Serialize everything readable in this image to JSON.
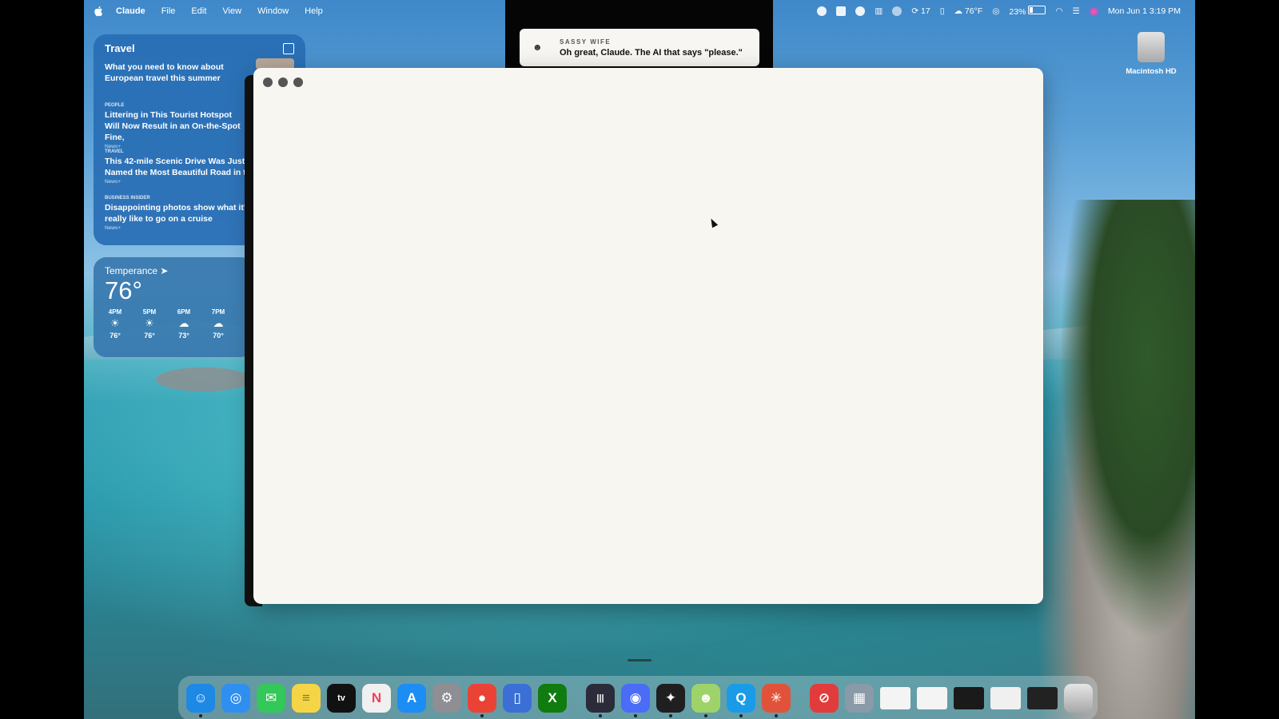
{
  "menubar": {
    "app_name": "Claude",
    "menus": [
      "File",
      "Edit",
      "View",
      "Window",
      "Help"
    ],
    "status": {
      "badge_count": "17",
      "weather": "76°F",
      "battery": "23%",
      "datetime": "Mon Jun 1  3:19 PM"
    }
  },
  "notification": {
    "title": "SASSY WIFE",
    "message": "Oh great, Claude. The AI that says \"please.\""
  },
  "news_widget": {
    "title": "Travel",
    "stories": [
      {
        "source": "",
        "headline": "What you need to know about European travel this summer",
        "tag": ""
      },
      {
        "source": "People",
        "headline": "Littering in This Tourist Hotspot Will Now Result in an On-the-Spot Fine,",
        "tag": "News+"
      },
      {
        "source": "Travel",
        "headline": "This 42-mile Scenic Drive Was Just Named the Most Beautiful Road in t",
        "tag": "News+"
      },
      {
        "source": "BUSINESS INSIDER",
        "headline": "Disappointing photos show what it' really like to go on a cruise",
        "tag": "News+"
      }
    ]
  },
  "weather_widget": {
    "location": "Temperance",
    "temperature": "76°",
    "hours": [
      {
        "time": "4PM",
        "icon": "sun",
        "temp": "76°"
      },
      {
        "time": "5PM",
        "icon": "sun",
        "temp": "76°"
      },
      {
        "time": "6PM",
        "icon": "cloud",
        "temp": "73°"
      },
      {
        "time": "7PM",
        "icon": "cloud",
        "temp": "70°"
      }
    ]
  },
  "desktop": {
    "drive_label": "Macintosh HD"
  },
  "dock": {
    "apps": [
      {
        "name": "finder",
        "glyph": "☺",
        "color": "#1e88e5",
        "running": true
      },
      {
        "name": "safari",
        "glyph": "◎",
        "color": "#2f8ff0",
        "running": false
      },
      {
        "name": "messages",
        "glyph": "✉",
        "color": "#34c759",
        "running": false
      },
      {
        "name": "notes",
        "glyph": "≡",
        "color": "#f5d546",
        "running": false
      },
      {
        "name": "apple-tv",
        "glyph": "tv",
        "color": "#111111",
        "running": false
      },
      {
        "name": "news",
        "glyph": "N",
        "color": "#f0f0f0",
        "running": false
      },
      {
        "name": "app-store",
        "glyph": "A",
        "color": "#1c8df5",
        "running": false
      },
      {
        "name": "system-settings",
        "glyph": "⚙",
        "color": "#8e8e93",
        "running": false
      },
      {
        "name": "chrome",
        "glyph": "●",
        "color": "#ea4335",
        "running": true
      },
      {
        "name": "simulator",
        "glyph": "▯",
        "color": "#3b6fd6",
        "running": false
      },
      {
        "name": "xbox-cloud-gaming",
        "glyph": "X",
        "color": "#107c10",
        "running": false
      },
      {
        "name": "audio-app",
        "glyph": "|||",
        "color": "#2b2b3a",
        "running": true
      },
      {
        "name": "messenger",
        "glyph": "◉",
        "color": "#4a6cf7",
        "running": true
      },
      {
        "name": "perplexity",
        "glyph": "✦",
        "color": "#1f1f1f",
        "running": true
      },
      {
        "name": "character-app",
        "glyph": "☻",
        "color": "#9ed36a",
        "running": true
      },
      {
        "name": "q-app",
        "glyph": "Q",
        "color": "#1a9be8",
        "running": true
      },
      {
        "name": "claude",
        "glyph": "✳",
        "color": "#e0533a",
        "running": true
      },
      {
        "name": "block-app",
        "glyph": "⊘",
        "color": "#e23b3b",
        "running": false
      },
      {
        "name": "preview",
        "glyph": "▦",
        "color": "#8a9aa8",
        "running": false
      }
    ],
    "trash_label": "trash"
  }
}
